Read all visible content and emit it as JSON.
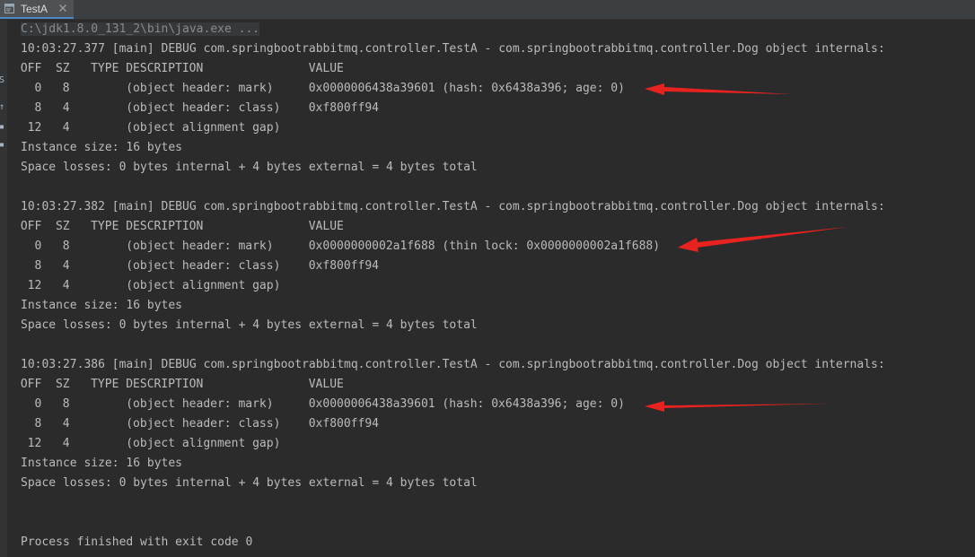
{
  "tab": {
    "label": "TestA",
    "icon": "console-window-icon",
    "close_icon": "close-icon"
  },
  "gutter": {
    "glyphs": [
      "S",
      "↑",
      "▪",
      "▪"
    ]
  },
  "console": {
    "command_line": "C:\\jdk1.8.0_131_2\\bin\\java.exe ...",
    "blocks": [
      {
        "log": "10:03:27.377 [main] DEBUG com.springbootrabbitmq.controller.TestA - com.springbootrabbitmq.controller.Dog object internals:",
        "header": " OFF  SZ   TYPE DESCRIPTION               VALUE",
        "rows": [
          "   0   8        (object header: mark)     0x0000006438a39601 (hash: 0x6438a396; age: 0)",
          "   8   4        (object header: class)    0xf800ff94",
          "  12   4        (object alignment gap)"
        ],
        "instance_size": "Instance size: 16 bytes",
        "space_losses": "Space losses: 0 bytes internal + 4 bytes external = 4 bytes total"
      },
      {
        "log": "10:03:27.382 [main] DEBUG com.springbootrabbitmq.controller.TestA - com.springbootrabbitmq.controller.Dog object internals:",
        "header": " OFF  SZ   TYPE DESCRIPTION               VALUE",
        "rows": [
          "   0   8        (object header: mark)     0x0000000002a1f688 (thin lock: 0x0000000002a1f688)",
          "   8   4        (object header: class)    0xf800ff94",
          "  12   4        (object alignment gap)"
        ],
        "instance_size": "Instance size: 16 bytes",
        "space_losses": "Space losses: 0 bytes internal + 4 bytes external = 4 bytes total"
      },
      {
        "log": "10:03:27.386 [main] DEBUG com.springbootrabbitmq.controller.TestA - com.springbootrabbitmq.controller.Dog object internals:",
        "header": " OFF  SZ   TYPE DESCRIPTION               VALUE",
        "rows": [
          "   0   8        (object header: mark)     0x0000006438a39601 (hash: 0x6438a396; age: 0)",
          "   8   4        (object header: class)    0xf800ff94",
          "  12   4        (object alignment gap)"
        ],
        "instance_size": "Instance size: 16 bytes",
        "space_losses": "Space losses: 0 bytes internal + 4 bytes external = 4 bytes total"
      }
    ],
    "exit_message": "Process finished with exit code 0"
  },
  "colors": {
    "background": "#2b2b2b",
    "text": "#bbbbbb",
    "annotation_arrow": "#e8231f"
  }
}
